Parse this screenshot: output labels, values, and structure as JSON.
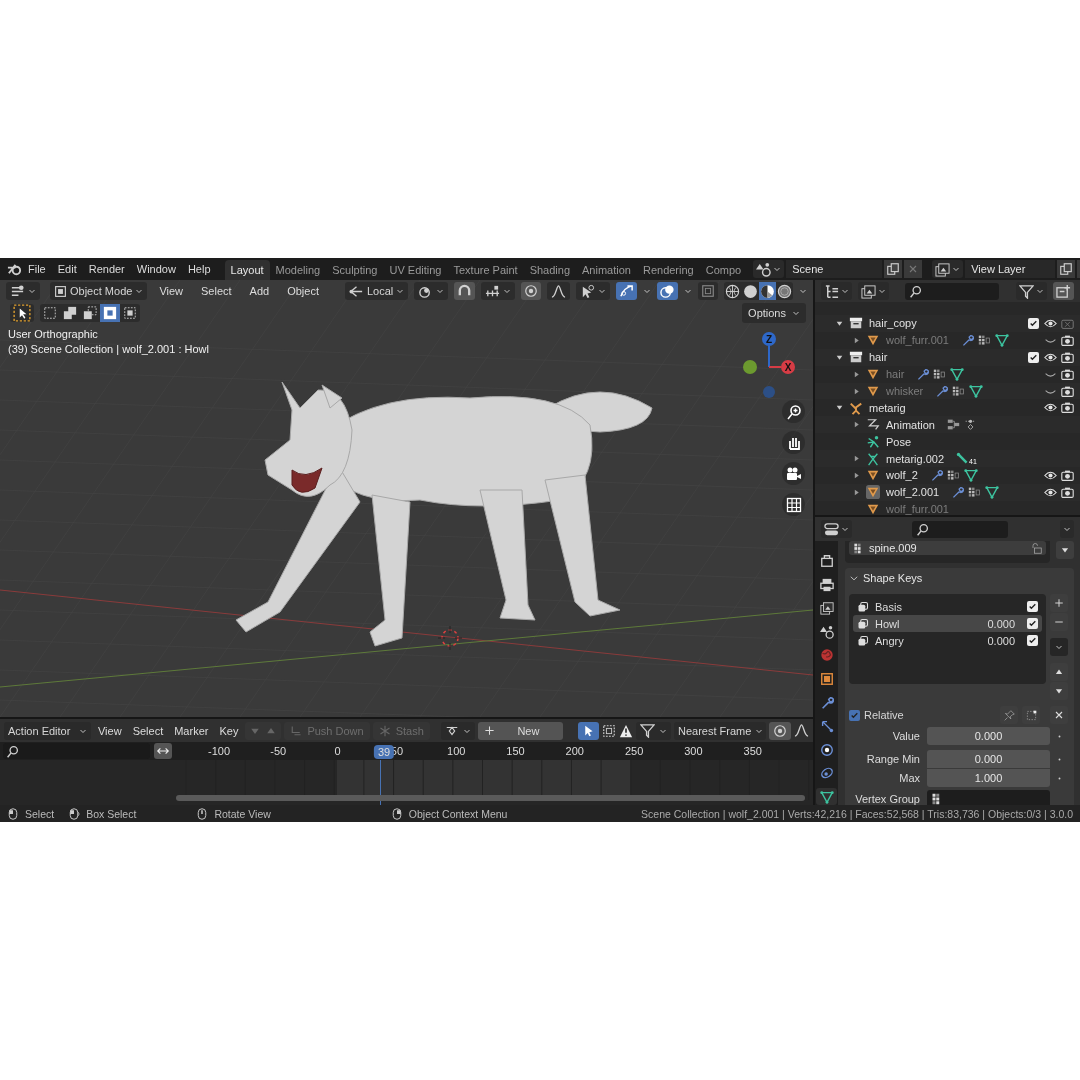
{
  "topbar": {
    "menus": [
      "File",
      "Edit",
      "Render",
      "Window",
      "Help"
    ],
    "workspaces": [
      {
        "label": "Layout",
        "selected": true
      },
      {
        "label": "Modeling",
        "selected": false
      },
      {
        "label": "Sculpting",
        "selected": false
      },
      {
        "label": "UV Editing",
        "selected": false
      },
      {
        "label": "Texture Paint",
        "selected": false
      },
      {
        "label": "Shading",
        "selected": false
      },
      {
        "label": "Animation",
        "selected": false
      },
      {
        "label": "Rendering",
        "selected": false
      },
      {
        "label": "Compo",
        "selected": false
      }
    ],
    "scene": "Scene",
    "view_layer": "View Layer"
  },
  "viewport": {
    "mode": "Object Mode",
    "menus": [
      "View",
      "Select",
      "Add",
      "Object"
    ],
    "orientation": "Local",
    "snap": true,
    "proportional": true,
    "gizmos": true,
    "overlays": true,
    "xray": false,
    "shading": [
      {
        "kind": "wireframe",
        "selected": false
      },
      {
        "kind": "solid",
        "selected": false
      },
      {
        "kind": "material",
        "selected": true
      },
      {
        "kind": "rendered",
        "selected": false
      }
    ],
    "select_modes": [
      {
        "kind": "set",
        "selected": false
      },
      {
        "kind": "extend",
        "selected": false
      },
      {
        "kind": "subtract",
        "selected": false
      },
      {
        "kind": "difference",
        "selected": true
      },
      {
        "kind": "intersect",
        "selected": false
      }
    ],
    "options": "Options",
    "info": [
      "User Orthographic",
      "(39) Scene Collection | wolf_2.001 : Howl"
    ],
    "axes": [
      {
        "label": "Z",
        "color": "#2e68c9"
      },
      {
        "label": "X",
        "color": "#d63c45"
      }
    ]
  },
  "outliner": {
    "items": [
      {
        "name": "hair_copy",
        "kind": "collection",
        "expanded": true,
        "dimmed": false,
        "checked": true,
        "visible": true,
        "renderable": false,
        "children": [
          {
            "name": "wolf_furr.001",
            "kind": "mesh",
            "expanded": false,
            "dimmed": true,
            "active": false,
            "visible": false,
            "renderable": true,
            "show_data": true
          }
        ]
      },
      {
        "name": "hair",
        "kind": "collection",
        "expanded": true,
        "dimmed": false,
        "checked": true,
        "visible": true,
        "renderable": true,
        "children": [
          {
            "name": "hair",
            "kind": "mesh",
            "expanded": false,
            "dimmed": true,
            "active": false,
            "visible": false,
            "renderable": true,
            "show_data": true
          },
          {
            "name": "whisker",
            "kind": "mesh",
            "expanded": false,
            "dimmed": true,
            "active": false,
            "visible": false,
            "renderable": true,
            "show_data": true
          }
        ]
      },
      {
        "name": "metarig",
        "kind": "armature",
        "expanded": true,
        "dimmed": false,
        "visible": true,
        "renderable": true,
        "children": [
          {
            "name": "Animation",
            "kind": "animation",
            "expanded": false,
            "dimmed": false,
            "active": false,
            "show_data": true
          },
          {
            "name": "Pose",
            "kind": "pose",
            "dimmed": false
          },
          {
            "name": "metarig.002",
            "kind": "armature_data",
            "expanded": false,
            "dimmed": false,
            "active": false,
            "show_data": true,
            "count": "41"
          },
          {
            "name": "wolf_2",
            "kind": "mesh",
            "expanded": false,
            "dimmed": false,
            "active": false,
            "visible": true,
            "renderable": true,
            "show_data": true
          },
          {
            "name": "wolf_2.001",
            "kind": "mesh",
            "expanded": false,
            "dimmed": false,
            "active": true,
            "visible": true,
            "renderable": true,
            "show_data": true
          },
          {
            "name": "wolf_furr.001",
            "kind": "mesh",
            "dimmed": true,
            "active": false,
            "show_data": false
          }
        ]
      }
    ]
  },
  "properties": {
    "tabs": [
      {
        "kind": "render",
        "selected": false
      },
      {
        "kind": "output",
        "selected": false
      },
      {
        "kind": "view_layer",
        "selected": false
      },
      {
        "kind": "scene",
        "selected": false
      },
      {
        "kind": "world",
        "selected": false
      },
      {
        "kind": "object",
        "selected": false
      },
      {
        "kind": "modifiers",
        "selected": false
      },
      {
        "kind": "particles",
        "selected": false
      },
      {
        "kind": "physics",
        "selected": false
      },
      {
        "kind": "constraints",
        "selected": false
      },
      {
        "kind": "data",
        "selected": true
      }
    ],
    "vertex_groups": [
      {
        "name": "spine.009",
        "selected": true
      }
    ],
    "shape_keys": {
      "title": "Shape Keys",
      "expanded": true,
      "keys": [
        {
          "name": "Basis",
          "checked": true,
          "selected": false
        },
        {
          "name": "Howl",
          "value": "0.000",
          "checked": true,
          "selected": true
        },
        {
          "name": "Angry",
          "value": "0.000",
          "checked": true,
          "selected": false
        }
      ],
      "relative": {
        "label": "Relative",
        "checked": true
      },
      "fields": [
        {
          "label": "Value",
          "value": "0.000",
          "kind": "number"
        },
        {
          "label": "Range Min",
          "value": "0.000",
          "kind": "range_top"
        },
        {
          "label": "Max",
          "value": "1.000",
          "kind": "range_bottom"
        },
        {
          "label": "Vertex Group",
          "kind": "search"
        }
      ]
    }
  },
  "action_editor": {
    "editor": "Action Editor",
    "menus": [
      "View",
      "Select",
      "Marker",
      "Key"
    ],
    "push_down": {
      "label": "Push Down",
      "disabled": true
    },
    "stash": {
      "label": "Stash",
      "disabled": true
    },
    "new": "New",
    "snap": "Nearest Frame",
    "ticks": [
      "-100",
      "-50",
      "0",
      "50",
      "100",
      "150",
      "200",
      "250",
      "300",
      "350"
    ],
    "frame": "39"
  },
  "status_bar": {
    "hints": [
      {
        "label": "Select",
        "kind": "left"
      },
      {
        "label": "Box Select",
        "kind": "drag"
      },
      {
        "label": "Rotate View",
        "kind": "middle"
      },
      {
        "label": "Object Context Menu",
        "kind": "right"
      }
    ],
    "stats": "Scene Collection | wolf_2.001 | Verts:42,216 | Faces:52,568 | Tris:83,736 | Objects:0/3 | 3.0.0"
  }
}
